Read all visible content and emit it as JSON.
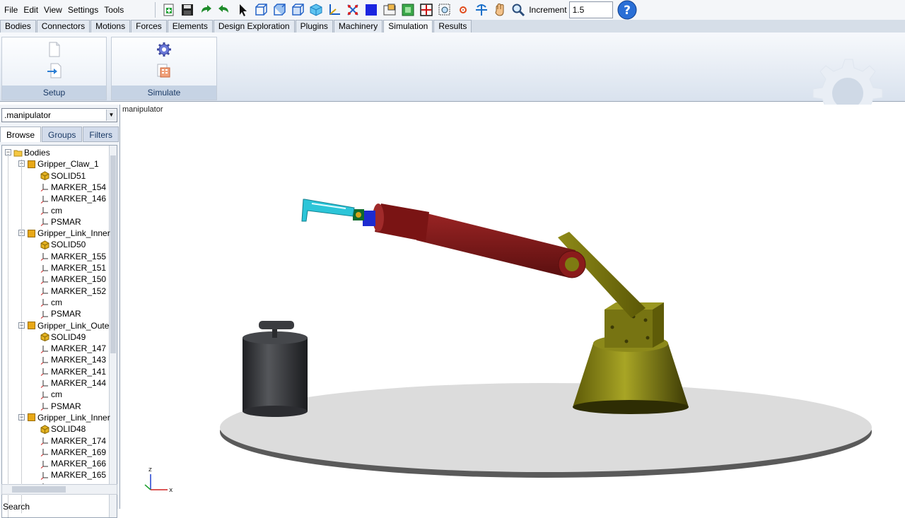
{
  "menu": [
    "File",
    "Edit",
    "View",
    "Settings",
    "Tools"
  ],
  "toolbar": {
    "increment_label": "Increment",
    "increment_value": "1.5",
    "buttons": [
      "new-icon",
      "save-icon",
      "redo-icon",
      "undo-icon",
      "select-arrow-icon",
      "view-front-icon",
      "view-top-icon",
      "view-side-icon",
      "view-iso-icon",
      "axes-icon",
      "grid-icon",
      "render-mode-icon",
      "fit-icon",
      "zoom-box-icon",
      "fit-all-icon",
      "zoom-window-icon",
      "center-icon",
      "rotate-icon",
      "pan-icon",
      "zoom-icon"
    ],
    "accent": "#2a6fd6"
  },
  "tabs": [
    "Bodies",
    "Connectors",
    "Motions",
    "Forces",
    "Elements",
    "Design Exploration",
    "Plugins",
    "Machinery",
    "Simulation",
    "Results"
  ],
  "active_tab": "Simulation",
  "ribbon": {
    "groups": [
      {
        "label": "Setup",
        "icons": [
          "document-icon",
          "import-icon"
        ]
      },
      {
        "label": "Simulate",
        "icons": [
          "gear-settings-icon",
          "calculator-icon"
        ]
      }
    ]
  },
  "left_panel": {
    "model": ".manipulator",
    "tabs": [
      "Browse",
      "Groups",
      "Filters"
    ],
    "active_tab": "Browse",
    "tree": [
      {
        "label": "Bodies",
        "level": 0,
        "type": "folder"
      },
      {
        "label": "Gripper_Claw_1",
        "level": 1,
        "type": "part"
      },
      {
        "label": "SOLID51",
        "level": 2,
        "type": "solid"
      },
      {
        "label": "MARKER_154",
        "level": 2,
        "type": "marker"
      },
      {
        "label": "MARKER_146",
        "level": 2,
        "type": "marker"
      },
      {
        "label": "cm",
        "level": 2,
        "type": "marker"
      },
      {
        "label": "PSMAR",
        "level": 2,
        "type": "marker"
      },
      {
        "label": "Gripper_Link_Inner",
        "level": 1,
        "type": "part"
      },
      {
        "label": "SOLID50",
        "level": 2,
        "type": "solid"
      },
      {
        "label": "MARKER_155",
        "level": 2,
        "type": "marker"
      },
      {
        "label": "MARKER_151",
        "level": 2,
        "type": "marker"
      },
      {
        "label": "MARKER_150",
        "level": 2,
        "type": "marker"
      },
      {
        "label": "MARKER_152",
        "level": 2,
        "type": "marker"
      },
      {
        "label": "cm",
        "level": 2,
        "type": "marker"
      },
      {
        "label": "PSMAR",
        "level": 2,
        "type": "marker"
      },
      {
        "label": "Gripper_Link_Oute",
        "level": 1,
        "type": "part"
      },
      {
        "label": "SOLID49",
        "level": 2,
        "type": "solid"
      },
      {
        "label": "MARKER_147",
        "level": 2,
        "type": "marker"
      },
      {
        "label": "MARKER_143",
        "level": 2,
        "type": "marker"
      },
      {
        "label": "MARKER_141",
        "level": 2,
        "type": "marker"
      },
      {
        "label": "MARKER_144",
        "level": 2,
        "type": "marker"
      },
      {
        "label": "cm",
        "level": 2,
        "type": "marker"
      },
      {
        "label": "PSMAR",
        "level": 2,
        "type": "marker"
      },
      {
        "label": "Gripper_Link_Inner",
        "level": 1,
        "type": "part"
      },
      {
        "label": "SOLID48",
        "level": 2,
        "type": "solid"
      },
      {
        "label": "MARKER_174",
        "level": 2,
        "type": "marker"
      },
      {
        "label": "MARKER_169",
        "level": 2,
        "type": "marker"
      },
      {
        "label": "MARKER_166",
        "level": 2,
        "type": "marker"
      },
      {
        "label": "MARKER_165",
        "level": 2,
        "type": "marker"
      },
      {
        "label": "cm",
        "level": 2,
        "type": "marker"
      }
    ],
    "search_label": "Search"
  },
  "viewport": {
    "title": "manipulator",
    "triad": {
      "z": "z",
      "x": "x"
    },
    "colors": {
      "base": "#7d7a0f",
      "arm": "#7a1515",
      "gripper": "#2cc5d8",
      "weight": "#333438",
      "ground": "#d7d7d7"
    }
  }
}
